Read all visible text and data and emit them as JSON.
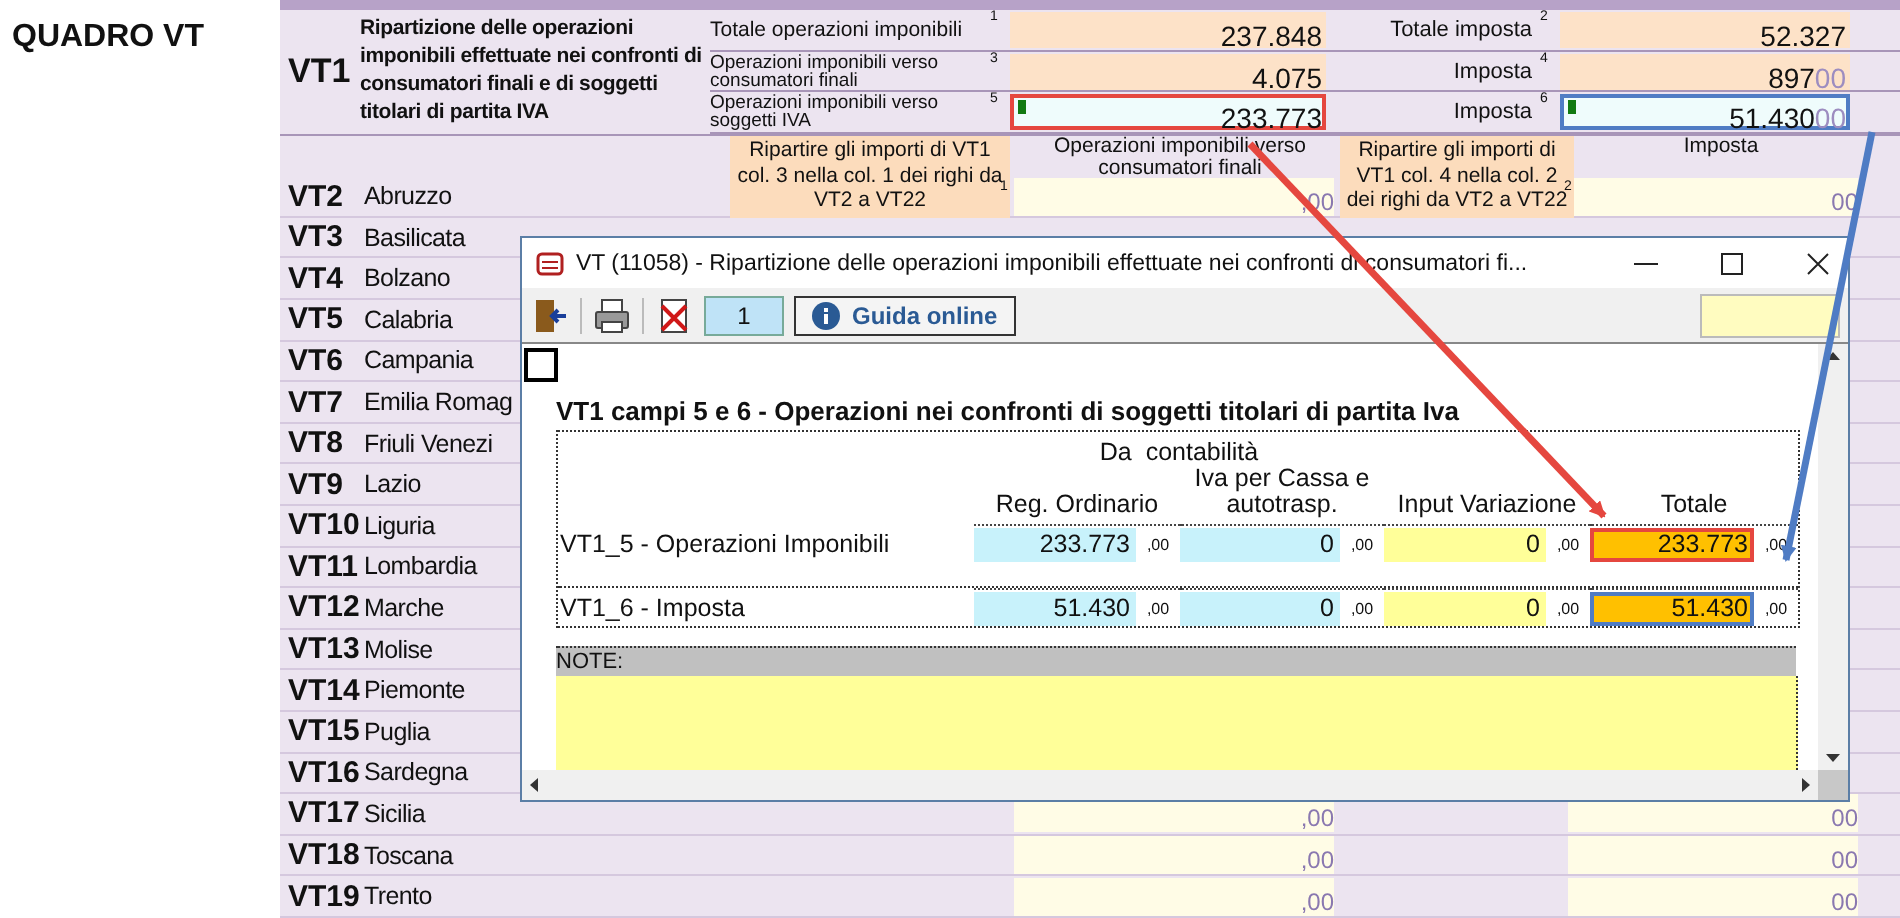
{
  "section_title": "QUADRO VT",
  "vt1": {
    "code": "VT1",
    "description": "Ripartizione delle operazioni imponibili effettuate nei confronti di consumatori finali e di soggetti titolari di partita IVA",
    "lines": [
      {
        "label": "Totale operazioni imponibili",
        "num": "1",
        "value": "237.848",
        "right_label": "Totale imposta",
        "right_num": "2",
        "right_value": "52.327",
        "highlighted": false
      },
      {
        "label": "Operazioni imponibili verso consumatori finali",
        "num": "3",
        "value": "4.075",
        "right_label": "Imposta",
        "right_num": "4",
        "right_value": "897",
        "right_decimals": "00",
        "highlighted": false
      },
      {
        "label": "Operazioni imponibili verso soggetti IVA",
        "num": "5",
        "value": "233.773",
        "right_label": "Imposta",
        "right_num": "6",
        "right_value": "51.430",
        "right_decimals": "00",
        "highlighted": true
      }
    ]
  },
  "header": {
    "note_left": "Ripartire gli importi di VT1 col. 3 nella col. 1 dei righi da VT2 a VT22",
    "note_left_num": "1",
    "col1_header": "Operazioni imponibili verso consumatori finali",
    "note_right": "Ripartire gli importi di VT1 col. 4 nella col. 2 dei righi da VT2 a VT22",
    "note_right_num": "2",
    "col2_header": "Imposta"
  },
  "rows": [
    {
      "code": "VT2",
      "name": "Abruzzo",
      "col1": ",00",
      "col2": "00"
    },
    {
      "code": "VT3",
      "name": "Basilicata"
    },
    {
      "code": "VT4",
      "name": "Bolzano"
    },
    {
      "code": "VT5",
      "name": "Calabria"
    },
    {
      "code": "VT6",
      "name": "Campania"
    },
    {
      "code": "VT7",
      "name": "Emilia Romag"
    },
    {
      "code": "VT8",
      "name": "Friuli Venezi"
    },
    {
      "code": "VT9",
      "name": "Lazio"
    },
    {
      "code": "VT10",
      "name": "Liguria"
    },
    {
      "code": "VT11",
      "name": "Lombardia"
    },
    {
      "code": "VT12",
      "name": "Marche"
    },
    {
      "code": "VT13",
      "name": "Molise"
    },
    {
      "code": "VT14",
      "name": "Piemonte"
    },
    {
      "code": "VT15",
      "name": "Puglia"
    },
    {
      "code": "VT16",
      "name": "Sardegna"
    },
    {
      "code": "VT17",
      "name": "Sicilia",
      "col1": ",00",
      "col2": "00"
    },
    {
      "code": "VT18",
      "name": "Toscana",
      "col1": ",00",
      "col2": "00"
    },
    {
      "code": "VT19",
      "name": "Trento",
      "col1": ",00",
      "col2": "00"
    }
  ],
  "dialog": {
    "title": "VT (11058) - Ripartizione delle operazioni imponibili effettuate nei confronti di consumatori fi...",
    "page": "1",
    "help_button": "Guida online",
    "checked": false,
    "heading": "VT1 campi 5 e 6 - Operazioni nei confronti di soggetti titolari di partita Iva",
    "group_header": "Da  contabilità",
    "columns": [
      "Reg. Ordinario",
      "Iva per Cassa e autotrasp.",
      "Input Variazione",
      "Totale"
    ],
    "rows": [
      {
        "label": "VT1_5 - Operazioni Imponibili",
        "color": "#e5473f",
        "cells": [
          {
            "kind": "accounting",
            "value": "233.773",
            "decimals": ",00"
          },
          {
            "kind": "accounting",
            "value": "0",
            "decimals": ",00"
          },
          {
            "kind": "input",
            "value": "0",
            "decimals": ",00"
          },
          {
            "kind": "total",
            "value": "233.773",
            "decimals": ",00"
          }
        ]
      },
      {
        "label": "VT1_6 - Imposta",
        "color": "#4f7cc4",
        "cells": [
          {
            "kind": "accounting",
            "value": "51.430",
            "decimals": ",00"
          },
          {
            "kind": "accounting",
            "value": "0",
            "decimals": ",00"
          },
          {
            "kind": "input",
            "value": "0",
            "decimals": ",00"
          },
          {
            "kind": "total",
            "value": "51.430",
            "decimals": ",00"
          }
        ]
      }
    ],
    "note_label": "NOTE:"
  }
}
